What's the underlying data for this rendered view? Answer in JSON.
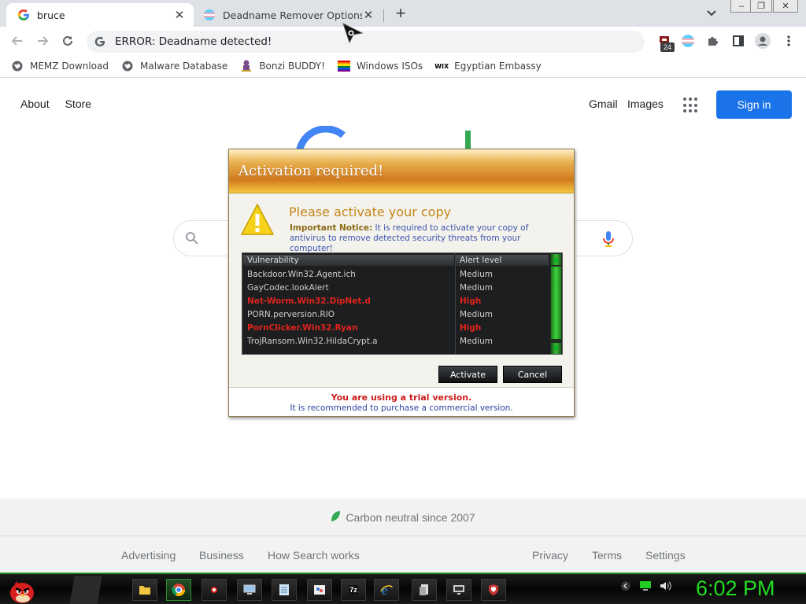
{
  "browser": {
    "tabs": [
      {
        "title": "bruce",
        "active": true
      },
      {
        "title": "Deadname Remover Options",
        "active": false
      }
    ],
    "address_bar": "ERROR: Deadname detected!",
    "extension_badge": "24",
    "bookmarks": [
      {
        "label": "MEMZ Download",
        "icon": "globe-icon"
      },
      {
        "label": "Malware Database",
        "icon": "globe-icon"
      },
      {
        "label": "Bonzi BUDDY!",
        "icon": "bonzi-icon"
      },
      {
        "label": "Windows ISOs",
        "icon": "rainbow-flag-icon"
      },
      {
        "label": "Egyptian Embassy",
        "icon": "wix-icon"
      }
    ]
  },
  "google": {
    "nav_left": [
      "About",
      "Store"
    ],
    "nav_right": [
      "Gmail",
      "Images"
    ],
    "sign_in": "Sign in",
    "carbon": "Carbon neutral since 2007",
    "footer_left": [
      "Advertising",
      "Business",
      "How Search works"
    ],
    "footer_right": [
      "Privacy",
      "Terms",
      "Settings"
    ],
    "colors": {
      "blue": "#1a73e8",
      "logo_blue": "#4285f4",
      "logo_green": "#34a853"
    }
  },
  "popup": {
    "title": "Activation required!",
    "heading": "Please activate your copy",
    "notice_label": "Important Notice:",
    "notice_text": "It is required to activate your copy of antivirus to remove detected security threats from your computer!",
    "columns": [
      "Vulnerability",
      "Alert level"
    ],
    "rows": [
      {
        "name": "Backdoor.Win32.Agent.ich",
        "level": "Medium"
      },
      {
        "name": "GayCodec.lookAlert",
        "level": "Medium"
      },
      {
        "name": "Net-Worm.Win32.DipNet.d",
        "level": "High"
      },
      {
        "name": "PORN.perversion.RIO",
        "level": "Medium"
      },
      {
        "name": "PornClicker.Win32.Ryan",
        "level": "High"
      },
      {
        "name": "TrojRansom.Win32.HildaCrypt.a",
        "level": "Medium"
      }
    ],
    "activate": "Activate",
    "cancel": "Cancel",
    "trial": "You are using a trial version.",
    "recommend": "It is recommended to purchase a commercial version.",
    "colors": {
      "high": "#e0241c",
      "header_orange": "#d17a1d"
    }
  },
  "taskbar": {
    "clock": "6:02 PM",
    "items": [
      "folder-icon",
      "chrome-icon",
      "record-icon",
      "monitor-icon",
      "notepad-icon",
      "paint-icon",
      "7zip-icon",
      "ie-icon",
      "file-icon",
      "remote-icon",
      "shield-icon"
    ],
    "accent": "#22dd22"
  }
}
